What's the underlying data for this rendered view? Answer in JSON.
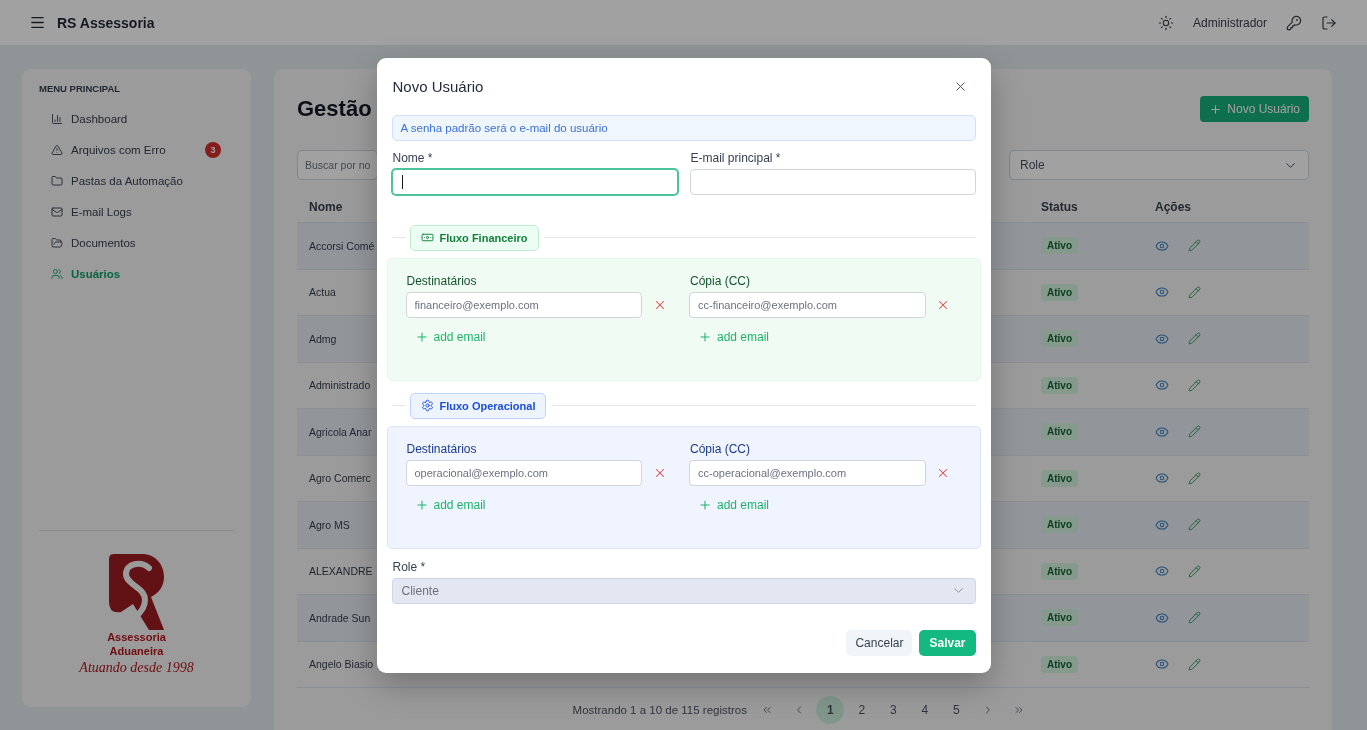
{
  "top_bar": {
    "title": "RS Assessoria",
    "user": "Administrador"
  },
  "sidebar": {
    "heading": "MENU PRINCIPAL",
    "items": [
      {
        "label": "Dashboard",
        "selected": false
      },
      {
        "label": "Arquivos com Erro",
        "selected": false,
        "badge": "3"
      },
      {
        "label": "Pastas da Automação",
        "selected": false
      },
      {
        "label": "E-mail Logs",
        "selected": false
      },
      {
        "label": "Documentos",
        "selected": false
      },
      {
        "label": "Usuários",
        "selected": true
      }
    ],
    "logo": {
      "lines": [
        "Assessoria",
        "Aduaneira"
      ],
      "tagline": "Atuando desde 1998"
    }
  },
  "main": {
    "title": "Gestão",
    "new_button": "Novo Usuário",
    "search": {
      "placeholder": "Buscar por no"
    },
    "role_filter": {
      "value": "Role"
    },
    "table": {
      "columns": [
        "Nome",
        "Status",
        "Ações"
      ],
      "rows": [
        {
          "name": "Accorsi Comé",
          "status": "Ativo"
        },
        {
          "name": "Actua",
          "status": "Ativo"
        },
        {
          "name": "Admg",
          "status": "Ativo"
        },
        {
          "name": "Administrado",
          "status": "Ativo"
        },
        {
          "name": "Agricola Anar",
          "status": "Ativo"
        },
        {
          "name": "Agro Comerc",
          "status": "Ativo"
        },
        {
          "name": "Agro MS",
          "status": "Ativo"
        },
        {
          "name": "ALEXANDRE",
          "status": "Ativo"
        },
        {
          "name": "Andrade Sun",
          "status": "Ativo"
        },
        {
          "name": "Angelo Biasio",
          "status": "Ativo"
        }
      ]
    },
    "pagination": {
      "summary": "Mostrando 1 a 10 de 115 registros",
      "pages": [
        {
          "label": "1",
          "selected": true
        },
        {
          "label": "2",
          "selected": false
        },
        {
          "label": "3",
          "selected": false
        },
        {
          "label": "4",
          "selected": false
        },
        {
          "label": "5",
          "selected": false
        }
      ]
    }
  },
  "modal": {
    "title": "Novo Usuário",
    "notice": "A senha padrão será o e-mail do usuário",
    "fields": [
      {
        "label": "Nome *",
        "focused": true
      },
      {
        "label": "E-mail principal *",
        "focused": false
      }
    ],
    "flows": [
      {
        "kind": "financeiro",
        "title": "Fluxo Financeiro",
        "groups": [
          {
            "label": "Destinatários",
            "emails": [
              {
                "placeholder": "financeiro@exemplo.com"
              }
            ],
            "add_label": "add email"
          },
          {
            "label": "Cópia (CC)",
            "emails": [
              {
                "placeholder": "cc-financeiro@exemplo.com"
              }
            ],
            "add_label": "add email"
          }
        ]
      },
      {
        "kind": "operacional",
        "title": "Fluxo Operacional",
        "groups": [
          {
            "label": "Destinatários",
            "emails": [
              {
                "placeholder": "operacional@exemplo.com"
              }
            ],
            "add_label": "add email"
          },
          {
            "label": "Cópia (CC)",
            "emails": [
              {
                "placeholder": "cc-operacional@exemplo.com"
              }
            ],
            "add_label": "add email"
          }
        ]
      }
    ],
    "role": {
      "label": "Role *",
      "value": "Cliente",
      "disabled": true
    },
    "actions": {
      "cancel": "Cancelar",
      "save": "Salvar"
    }
  }
}
